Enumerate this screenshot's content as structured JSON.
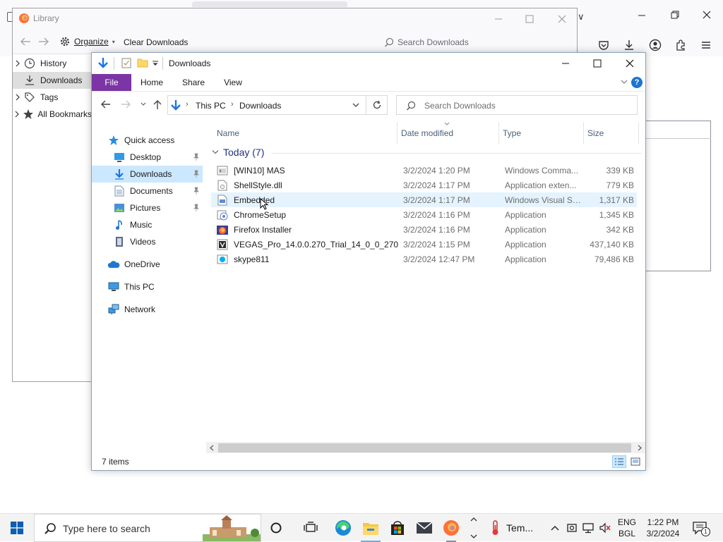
{
  "browser": {
    "toolbar_icons": [
      "pocket-icon",
      "downloads-icon",
      "account-icon",
      "extensions-icon",
      "menu-icon"
    ]
  },
  "library": {
    "title": "Library",
    "toolbar": {
      "organize_label": "Organize",
      "clear_downloads_label": "Clear Downloads",
      "search_placeholder": "Search Downloads"
    },
    "sidebar": [
      {
        "label": "History",
        "icon": "clock-icon",
        "expandable": true,
        "selected": false
      },
      {
        "label": "Downloads",
        "icon": "download-icon",
        "expandable": false,
        "selected": true
      },
      {
        "label": "Tags",
        "icon": "tag-icon",
        "expandable": true,
        "selected": false
      },
      {
        "label": "All Bookmarks",
        "icon": "star-icon",
        "expandable": true,
        "selected": false
      }
    ]
  },
  "explorer": {
    "title": "Downloads",
    "ribbon_tabs": [
      "File",
      "Home",
      "Share",
      "View"
    ],
    "help_label": "?",
    "address": {
      "crumbs": [
        "This PC",
        "Downloads"
      ]
    },
    "search_placeholder": "Search Downloads",
    "nav": {
      "quick_access": "Quick access",
      "items": [
        {
          "label": "Desktop",
          "icon": "desktop-icon",
          "pinned": true,
          "selected": false
        },
        {
          "label": "Downloads",
          "icon": "downloads-folder-icon",
          "pinned": true,
          "selected": true
        },
        {
          "label": "Documents",
          "icon": "documents-icon",
          "pinned": true,
          "selected": false
        },
        {
          "label": "Pictures",
          "icon": "pictures-icon",
          "pinned": true,
          "selected": false
        },
        {
          "label": "Music",
          "icon": "music-icon",
          "pinned": false,
          "selected": false
        },
        {
          "label": "Videos",
          "icon": "videos-icon",
          "pinned": false,
          "selected": false
        }
      ],
      "onedrive": "OneDrive",
      "this_pc": "This PC",
      "network": "Network"
    },
    "columns": [
      "Name",
      "Date modified",
      "Type",
      "Size"
    ],
    "group": "Today (7)",
    "files": [
      {
        "name": "[WIN10] MAS",
        "date": "3/2/2024 1:20 PM",
        "type": "Windows Comma...",
        "size": "339 KB",
        "icon": "cmd-file-icon"
      },
      {
        "name": "ShellStyle.dll",
        "date": "3/2/2024 1:17 PM",
        "type": "Application exten...",
        "size": "779 KB",
        "icon": "dll-file-icon"
      },
      {
        "name": "Embedded",
        "date": "3/2/2024 1:17 PM",
        "type": "Windows Visual St...",
        "size": "1,317 KB",
        "icon": "vbs-file-icon"
      },
      {
        "name": "ChromeSetup",
        "date": "3/2/2024 1:16 PM",
        "type": "Application",
        "size": "1,345 KB",
        "icon": "chrome-setup-icon"
      },
      {
        "name": "Firefox Installer",
        "date": "3/2/2024 1:16 PM",
        "type": "Application",
        "size": "342 KB",
        "icon": "firefox-installer-icon"
      },
      {
        "name": "VEGAS_Pro_14.0.0.270_Trial_14_0_0_270",
        "date": "3/2/2024 1:15 PM",
        "type": "Application",
        "size": "437,140 KB",
        "icon": "vegas-installer-icon"
      },
      {
        "name": "skype811",
        "date": "3/2/2024 12:47 PM",
        "type": "Application",
        "size": "79,486 KB",
        "icon": "skype-installer-icon"
      }
    ],
    "status": "7 items"
  },
  "taskbar": {
    "search_placeholder": "Type here to search",
    "weather_label": "Tem...",
    "lang": [
      "ENG",
      "BGL"
    ],
    "time": "1:22 PM",
    "date": "3/2/2024",
    "notification_count": "1"
  }
}
